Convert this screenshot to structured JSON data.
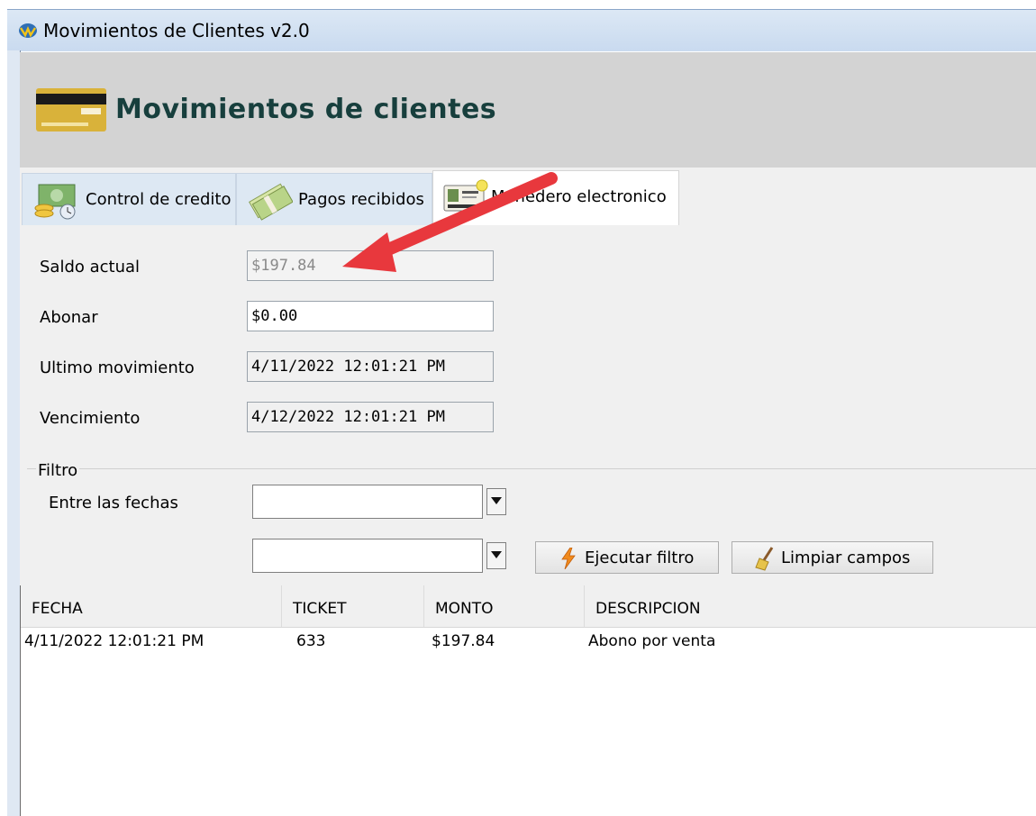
{
  "window": {
    "title": "Movimientos de Clientes v2.0"
  },
  "header": {
    "title": "Movimientos de clientes"
  },
  "tabs": [
    {
      "label": "Control de credito"
    },
    {
      "label": "Pagos recibidos"
    },
    {
      "label": "Monedero electronico"
    }
  ],
  "form": {
    "saldo_label": "Saldo actual",
    "saldo_value": "$197.84",
    "abonar_label": "Abonar",
    "abonar_value": "$0.00",
    "ultimo_label": "Ultimo movimiento",
    "ultimo_value": "4/11/2022 12:01:21 PM",
    "venc_label": "Vencimiento",
    "venc_value": "4/12/2022 12:01:21 PM"
  },
  "filter": {
    "group_label": "Filtro",
    "between_label": "Entre las fechas",
    "run_button": "Ejecutar filtro",
    "clear_button": "Limpiar campos"
  },
  "table": {
    "columns": [
      "FECHA",
      "TICKET",
      "MONTO",
      "DESCRIPCION"
    ],
    "rows": [
      [
        "4/11/2022 12:01:21 PM",
        "633",
        "$197.84",
        "Abono por venta"
      ]
    ]
  },
  "colors": {
    "header_title": "#173f3d",
    "annotation_arrow": "#e8383d"
  }
}
